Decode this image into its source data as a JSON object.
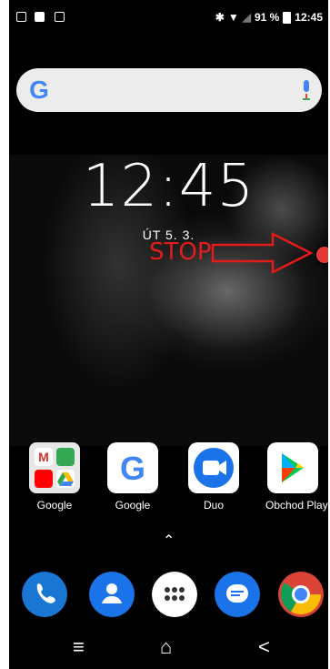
{
  "status_bar": {
    "battery_percent": "91 %",
    "time": "12:45",
    "left_icons": [
      "play-notification-icon",
      "image-notification-icon",
      "file-notification-icon"
    ],
    "right_icons": [
      "bluetooth-icon",
      "wifi-icon",
      "signal-icon",
      "battery-icon"
    ]
  },
  "search_widget": {
    "logo": "G"
  },
  "lockscreen": {
    "time": "12:45",
    "date": "ÚT 5. 3."
  },
  "annotation": {
    "stop_label": "STOP",
    "color": "#e21b1b"
  },
  "apps": [
    {
      "label": "Google",
      "icon": "google-folder-icon"
    },
    {
      "label": "Google",
      "icon": "google-icon"
    },
    {
      "label": "Duo",
      "icon": "duo-icon"
    },
    {
      "label": "Obchod Play",
      "icon": "play-store-icon"
    }
  ],
  "dock": [
    {
      "icon": "phone-icon"
    },
    {
      "icon": "contacts-icon"
    },
    {
      "icon": "app-drawer-icon"
    },
    {
      "icon": "messages-icon"
    },
    {
      "icon": "chrome-icon"
    }
  ],
  "nav": {
    "menu_glyph": "≡",
    "home_glyph": "⌂",
    "back_glyph": "<",
    "drawer_glyph": "⌃"
  }
}
